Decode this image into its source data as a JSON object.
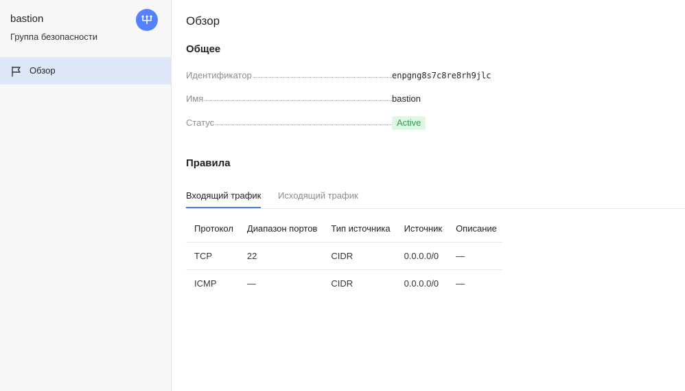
{
  "sidebar": {
    "resource_name": "bastion",
    "resource_type": "Группа безопасности",
    "service_icon": "vpc-network-icon",
    "nav_items": [
      {
        "label": "Обзор",
        "icon": "flag-icon",
        "active": true
      }
    ]
  },
  "main": {
    "title": "Обзор",
    "general": {
      "title": "Общее",
      "properties": [
        {
          "label": "Идентификатор",
          "value": "enpgng8s7c8re8rh9jlc"
        },
        {
          "label": "Имя",
          "value": "bastion"
        },
        {
          "label": "Статус",
          "value": "Active"
        }
      ]
    },
    "rules": {
      "title": "Правила",
      "tabs": [
        {
          "label": "Входящий трафик",
          "active": true
        },
        {
          "label": "Исходящий трафик",
          "active": false
        }
      ],
      "columns": [
        "Протокол",
        "Диапазон портов",
        "Тип источника",
        "Источник",
        "Описание"
      ],
      "rows": [
        [
          "TCP",
          "22",
          "CIDR",
          "0.0.0.0/0",
          "—"
        ],
        [
          "ICMP",
          "—",
          "CIDR",
          "0.0.0.0/0",
          "—"
        ]
      ]
    }
  },
  "colors": {
    "accent": "#5282ff",
    "tab_underline": "#4d7de8",
    "nav_active_bg": "#dfe7f9",
    "status_bg": "#def7e4",
    "status_text": "#33994d"
  }
}
